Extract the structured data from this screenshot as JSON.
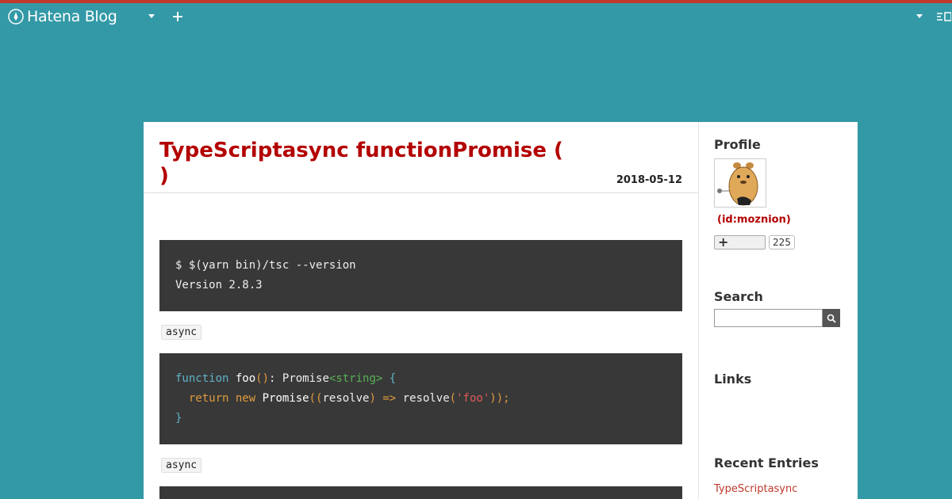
{
  "header": {
    "logo_text": "Hatena Blog",
    "logo_icon": "pen-icon",
    "blog_menu_icon": "chevron-down-icon",
    "add_icon": "plus-icon",
    "user_menu_icon": "chevron-down-icon"
  },
  "entry": {
    "title": "TypeScriptasync functionPromise (    )",
    "date": "2018-05-12",
    "code_blocks": [
      [
        "$ $(yarn bin)/tsc --version",
        "Version 2.8.3"
      ]
    ],
    "inline_codes": [
      "async",
      "async"
    ]
  },
  "sidebar": {
    "profile_title": "Profile",
    "profile_id": "(id:moznion)",
    "subscribe_icon": "plus-icon",
    "subscribers_count": "225",
    "search_title": "Search",
    "search_placeholder": "",
    "search_icon": "search-icon",
    "links_title": "Links",
    "recent_title": "Recent Entries",
    "recent_entries": [
      "TypeScriptasync"
    ]
  },
  "colors": {
    "background": "#3399a6",
    "top_bar": "#c0392b",
    "title": "#b30000",
    "code_bg": "#383838"
  }
}
